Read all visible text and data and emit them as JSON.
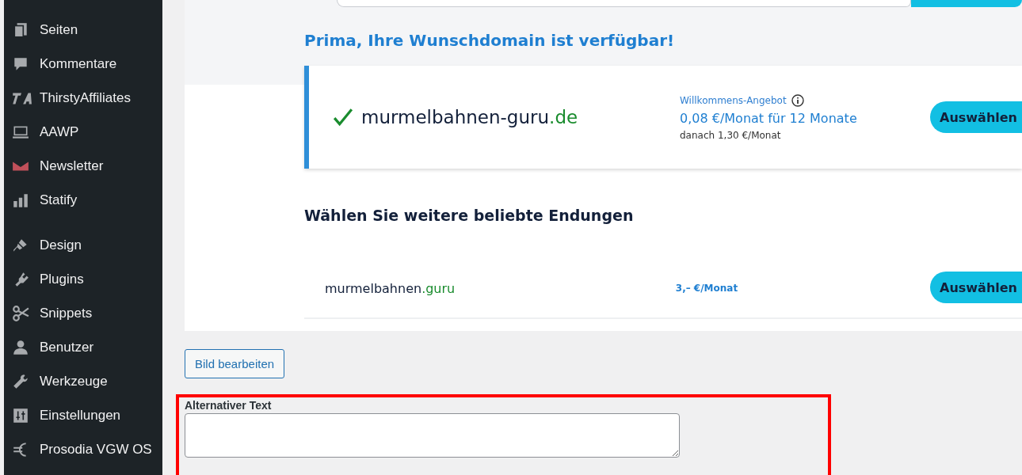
{
  "sidebar": {
    "groups": [
      {
        "items": [
          {
            "label": "Seiten"
          },
          {
            "label": "Kommentare"
          },
          {
            "label": "ThirstyAffiliates"
          },
          {
            "label": "AAWP"
          },
          {
            "label": "Newsletter"
          },
          {
            "label": "Statify"
          }
        ]
      },
      {
        "items": [
          {
            "label": "Design"
          },
          {
            "label": "Plugins"
          },
          {
            "label": "Snippets"
          },
          {
            "label": "Benutzer"
          },
          {
            "label": "Werkzeuge"
          },
          {
            "label": "Einstellungen"
          },
          {
            "label": "Prosodia VGW OS"
          }
        ]
      }
    ]
  },
  "screenshot": {
    "heading": "Prima, Ihre Wunschdomain ist verfügbar!",
    "featured": {
      "name": "murmelbahnen-guru",
      "tld": ".de",
      "offer_label": "Willkommens-Angebot",
      "price": "0,08 €/Monat für 12 Monate",
      "after": "danach 1,30 €/Monat",
      "button": "Auswählen"
    },
    "more_heading": "Wählen Sie weitere beliebte Endungen",
    "rows": [
      {
        "name": "murmelbahnen",
        "tld": ".guru",
        "price": "3,– €/Monat",
        "button": "Auswählen"
      }
    ]
  },
  "edit_button": "Bild bearbeiten",
  "alt_text": {
    "label": "Alternativer Text"
  }
}
